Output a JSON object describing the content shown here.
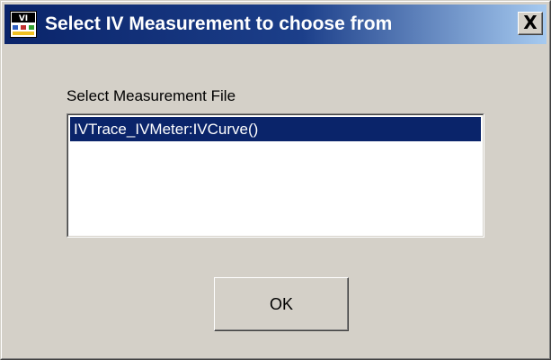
{
  "window": {
    "title": "Select IV Measurement to choose from",
    "icon": "vi-app-icon",
    "close_label": "X"
  },
  "dialog": {
    "list_label": "Select Measurement File",
    "items": [
      {
        "label": "IVTrace_IVMeter:IVCurve()",
        "selected": true
      }
    ],
    "ok_label": "OK"
  },
  "colors": {
    "titlebar_start": "#0a246a",
    "titlebar_end": "#a6caf0",
    "selection": "#0a246a",
    "face": "#d4d0c8"
  }
}
